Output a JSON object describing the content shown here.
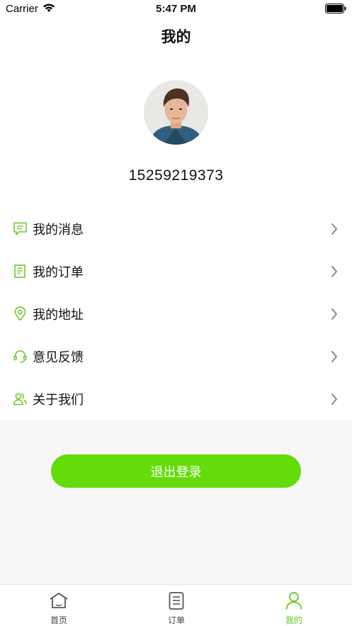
{
  "status_bar": {
    "carrier": "Carrier",
    "time": "5:47 PM"
  },
  "header": {
    "title": "我的"
  },
  "profile": {
    "phone": "15259219373",
    "avatar_icon": "user-photo"
  },
  "menu": [
    {
      "label": "我的消息",
      "icon": "message-icon"
    },
    {
      "label": "我的订单",
      "icon": "order-list-icon"
    },
    {
      "label": "我的地址",
      "icon": "location-pin-icon"
    },
    {
      "label": "意见反馈",
      "icon": "headset-icon"
    },
    {
      "label": "关于我们",
      "icon": "users-icon"
    }
  ],
  "logout": {
    "label": "退出登录"
  },
  "tabs": [
    {
      "label": "首页",
      "icon": "home-icon",
      "active": false
    },
    {
      "label": "订单",
      "icon": "order-icon",
      "active": false
    },
    {
      "label": "我的",
      "icon": "profile-icon",
      "active": true
    }
  ],
  "colors": {
    "accent": "#64dc0a",
    "accent_text": "#64c81e",
    "background": "#f7f7f7"
  }
}
